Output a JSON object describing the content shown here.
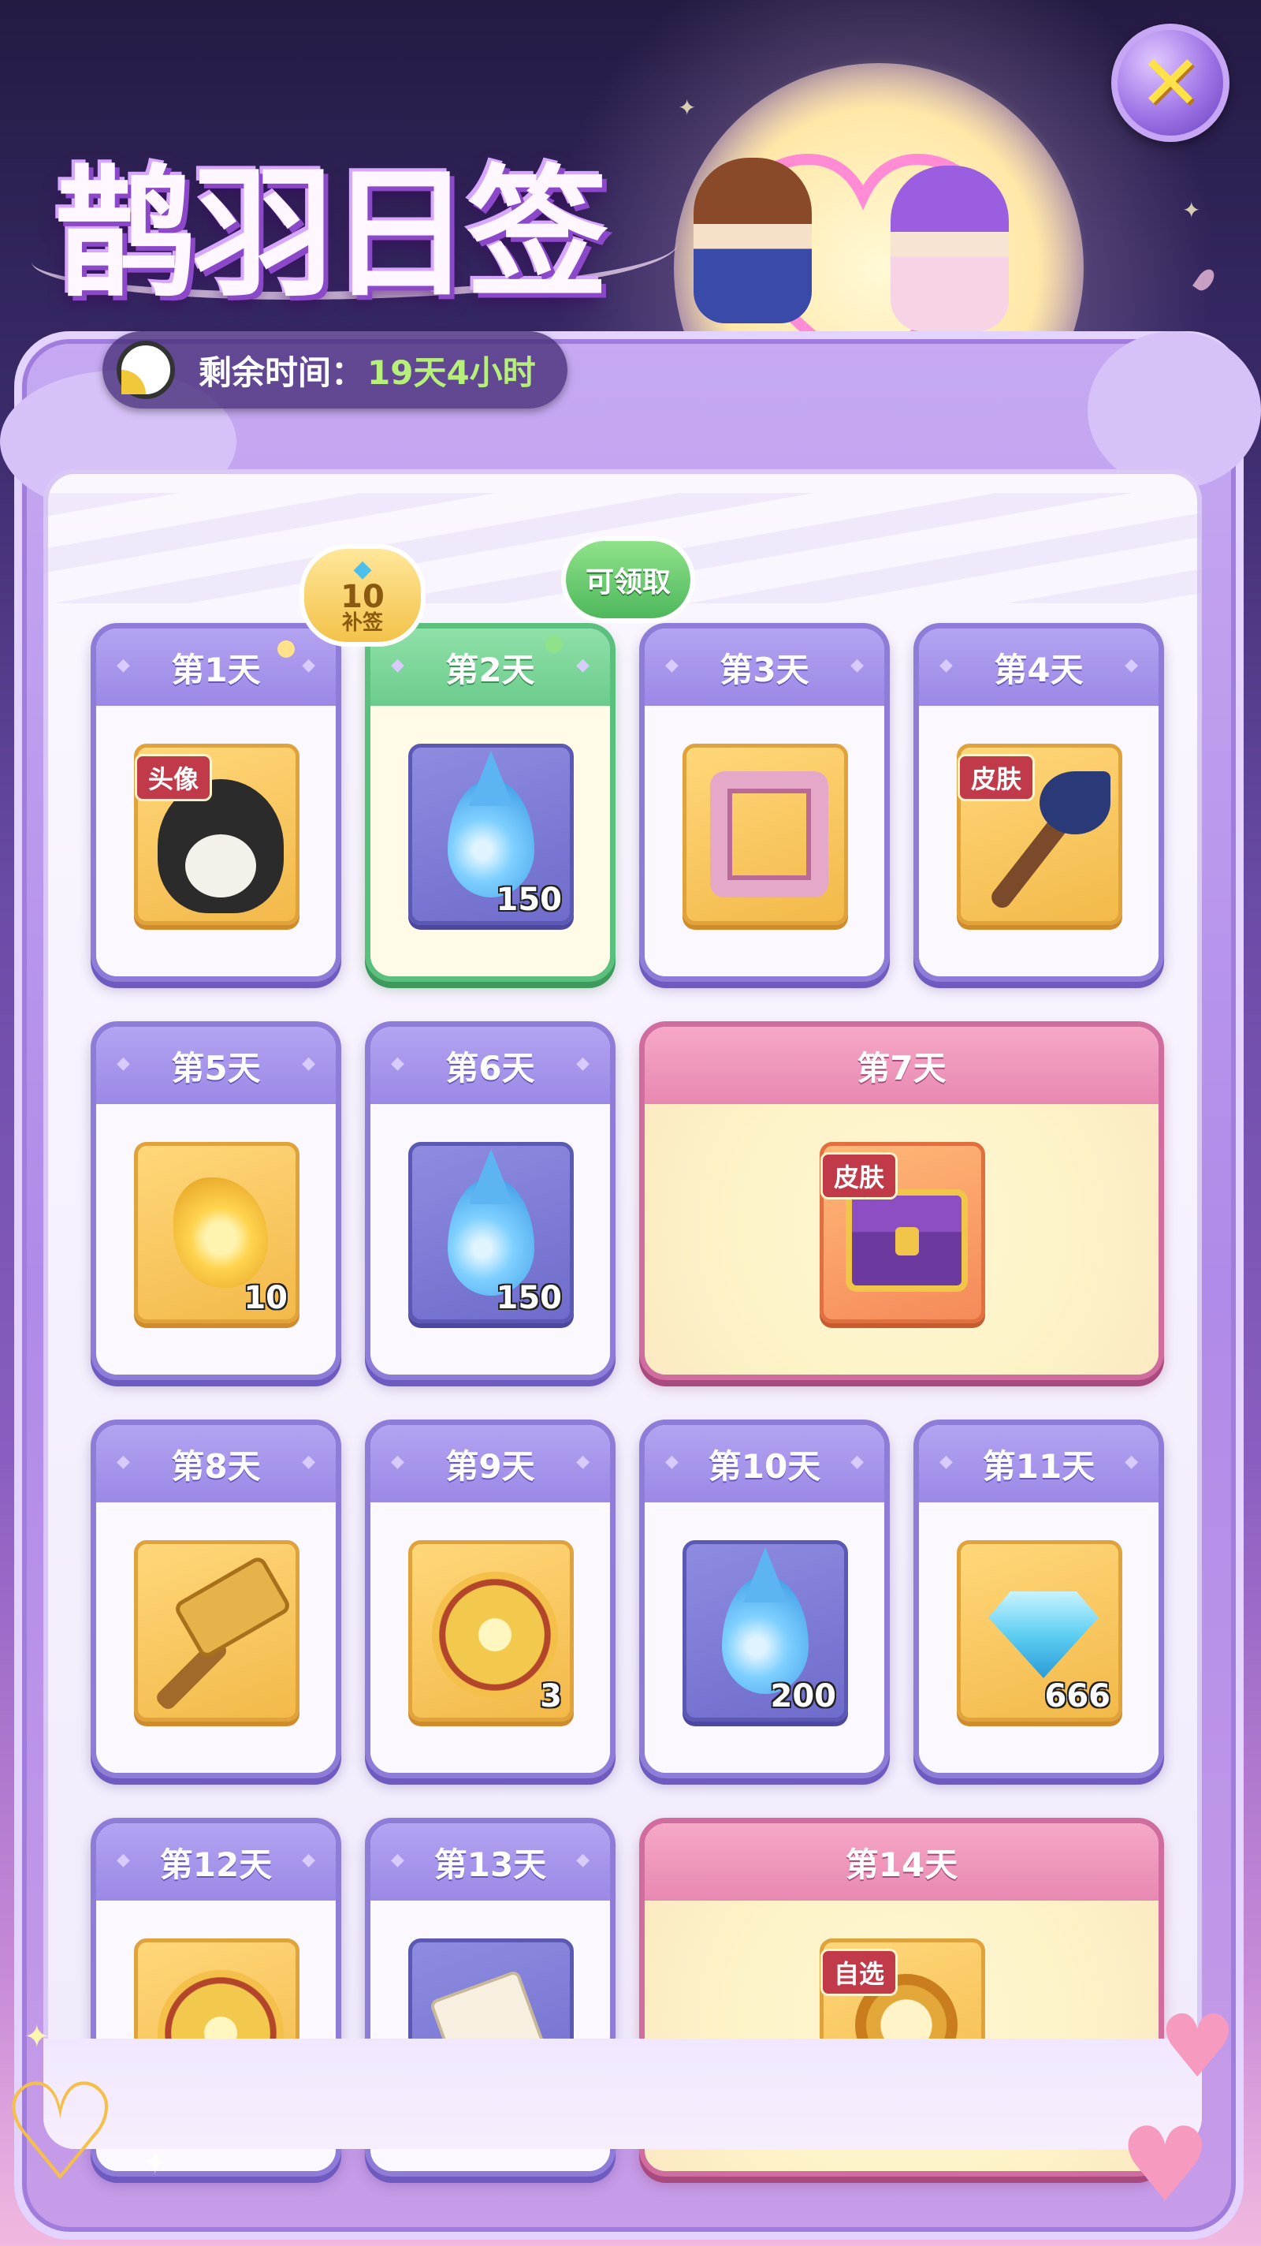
{
  "header": {
    "title": "鹊羽日签",
    "timer_label": "剩余时间：",
    "timer_value": "19天4小时",
    "close_icon": "✕"
  },
  "bubbles": {
    "day1_reward_amount": "10",
    "day1_reward_label": "补签",
    "day2_status": "可领取"
  },
  "days": [
    {
      "label": "第1天",
      "tag": "头像",
      "icon": "dog-avatar-icon",
      "qty": ""
    },
    {
      "label": "第2天",
      "tag": "",
      "icon": "water-drop-icon",
      "qty": "150"
    },
    {
      "label": "第3天",
      "tag": "",
      "icon": "avatar-frame-icon",
      "qty": ""
    },
    {
      "label": "第4天",
      "tag": "皮肤",
      "icon": "magic-wand-icon",
      "qty": ""
    },
    {
      "label": "第5天",
      "tag": "",
      "icon": "golden-scroll-icon",
      "qty": "10"
    },
    {
      "label": "第6天",
      "tag": "",
      "icon": "water-drop-icon",
      "qty": "150"
    },
    {
      "label": "第7天",
      "tag": "皮肤",
      "icon": "treasure-chest-icon",
      "qty": ""
    },
    {
      "label": "第8天",
      "tag": "",
      "icon": "golden-hammer-icon",
      "qty": ""
    },
    {
      "label": "第9天",
      "tag": "",
      "icon": "flower-medal-icon",
      "qty": "3"
    },
    {
      "label": "第10天",
      "tag": "",
      "icon": "water-drop-icon",
      "qty": "200"
    },
    {
      "label": "第11天",
      "tag": "",
      "icon": "diamond-icon",
      "qty": "666"
    },
    {
      "label": "第12天",
      "tag": "",
      "icon": "flower-medal-icon",
      "qty": ""
    },
    {
      "label": "第13天",
      "tag": "",
      "icon": "ticket-star-icon",
      "qty": ""
    },
    {
      "label": "第14天",
      "tag": "自选",
      "icon": "pocket-watch-icon",
      "qty": ""
    }
  ],
  "colors": {
    "accent_purple": "#9c88e6",
    "claimable_green": "#6ccc8d",
    "special_pink": "#e888b2",
    "timer_green": "#b6f07a"
  }
}
